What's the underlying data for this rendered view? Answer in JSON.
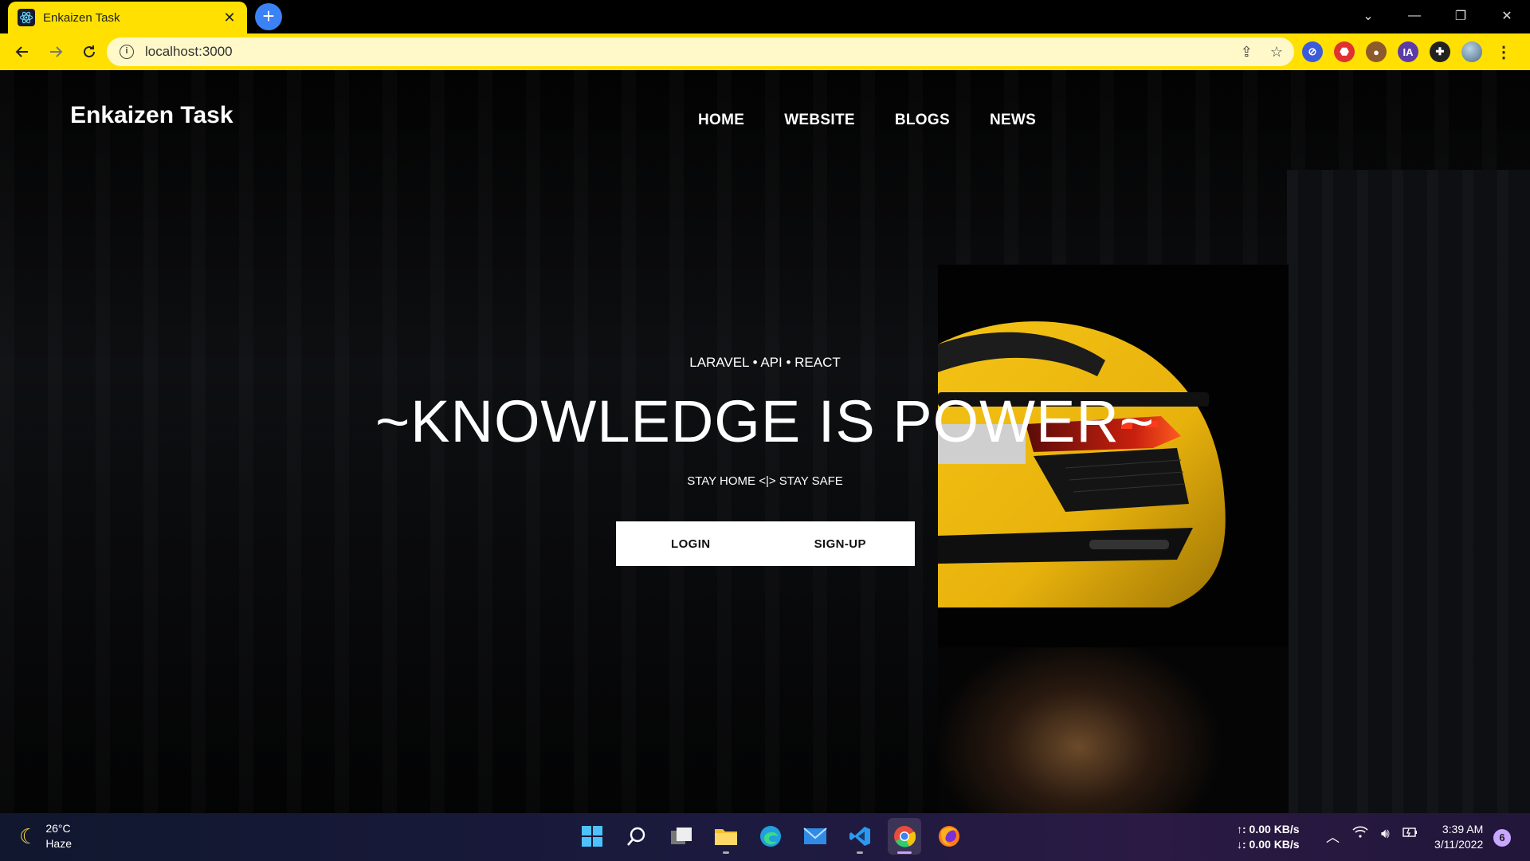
{
  "browser": {
    "tab_title": "Enkaizen Task",
    "tab_close": "✕",
    "new_tab": "+",
    "url": "localhost:3000",
    "win_controls": {
      "minimize": "—",
      "restore": "❐",
      "close": "✕",
      "tabs": "⌄"
    },
    "accent_color": "#ffe000",
    "extensions": [
      {
        "name": "blocker-icon",
        "glyph": "⊘",
        "color": "#3b5bdb"
      },
      {
        "name": "adblock-icon",
        "glyph": "⬣",
        "color": "#e03131"
      },
      {
        "name": "cookie-icon",
        "glyph": "●",
        "color": "#8d5a2b"
      },
      {
        "name": "ia-icon",
        "glyph": "IA",
        "color": "#5c3aa8"
      },
      {
        "name": "puzzle-icon",
        "glyph": "✚",
        "color": "#222222"
      }
    ]
  },
  "site": {
    "brand": "Enkaizen Task",
    "nav": [
      "HOME",
      "WEBSITE",
      "BLOGS",
      "NEWS"
    ],
    "hero": {
      "tagline": "LARAVEL • API • REACT",
      "title": "~KNOWLEDGE IS POWER~",
      "subtitle": "STAY HOME <|> STAY SAFE",
      "login_label": "LOGIN",
      "signup_label": "SIGN-UP"
    }
  },
  "taskbar": {
    "weather_temp": "26°C",
    "weather_desc": "Haze",
    "net_up": "↑: 0.00 KB/s",
    "net_down": "↓: 0.00 KB/s",
    "time": "3:39 AM",
    "date": "3/11/2022",
    "notifications": "6"
  }
}
